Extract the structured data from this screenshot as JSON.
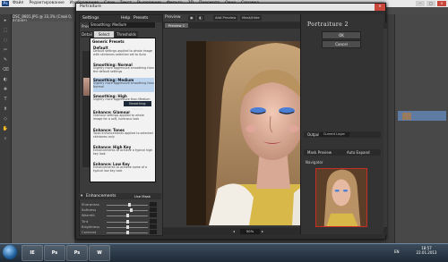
{
  "photoshop": {
    "logo": "Ps",
    "menus": [
      "Файл",
      "Редактирование",
      "Изображение",
      "Слои",
      "Текст",
      "Выделение",
      "Фильтр",
      "3D",
      "Просмотр",
      "Окно",
      "Справка"
    ],
    "window_buttons": [
      "–",
      "□",
      "×"
    ],
    "document_tab": "DSC_8801.JPG @ 33,3% (Слой 0, RGB/8*)"
  },
  "window": {
    "title": "Portraiture",
    "close": "×"
  },
  "settings": {
    "header": "Settings",
    "header_help": "Help",
    "header_presets": "Presets",
    "preset_label": "Preset:",
    "preset_value": "Smoothing: Medium",
    "tabs": [
      "Detail",
      "Select Only",
      "Thresholds"
    ]
  },
  "preset_list": {
    "group": "Generic Presets",
    "items": [
      {
        "name": "Default",
        "desc": "Default settings applied to whole image with skintones selection set to Auto"
      },
      {
        "name": "Smoothing: Normal",
        "desc": "Slightly more aggressive smoothing than the default settings"
      },
      {
        "name": "Smoothing: Medium",
        "desc": "Slightly more aggressive smoothing than Normal"
      },
      {
        "name": "Smoothing: High",
        "desc": "Slightly more aggressive than Medium"
      },
      {
        "name": "Enhance: Glamour",
        "desc": "Glamour settings applied to whole image for a soft, luminous look"
      },
      {
        "name": "Enhance: Tones",
        "desc": "Tonal enhancements applied to selected skintones only"
      },
      {
        "name": "Enhance: High Key",
        "desc": "Enhancements to achieve a typical high key look"
      },
      {
        "name": "Enhance: Low Key",
        "desc": "Enhancements to achieve some of a typical low key look"
      }
    ],
    "hover_tip": "Smoothing: Medium"
  },
  "enhancements": {
    "header": "Enhancements",
    "use_mask": "Use Mask",
    "rows": [
      {
        "label": "Sharpness",
        "value": 0.55
      },
      {
        "label": "Softness",
        "value": 0.6
      },
      {
        "label": "Warmth",
        "value": 0.5
      },
      {
        "label": "Tint",
        "value": 0.5
      },
      {
        "label": "Brightness",
        "value": 0.5
      },
      {
        "label": "Contrast",
        "value": 0.5
      }
    ]
  },
  "preview": {
    "title": "Preview",
    "add_preview": "Add Preview",
    "mask_button": "Mask/Hide",
    "fast_preview": "Fast Preview",
    "accurate": "Accurate",
    "tab": "Preview 1",
    "zoom": "50%"
  },
  "right": {
    "logo": "Portraiture 2",
    "ok": "OK",
    "cancel": "Cancel",
    "output_label": "Output",
    "output_value": "Current Layer",
    "mask_preview": "Mask Preview",
    "auto_expand": "Auto Expand",
    "navigator": "Navigator"
  },
  "taskbar": {
    "apps": [
      "IE",
      "Ps",
      "Ps",
      "W"
    ],
    "lang": "EN",
    "time": "18:57",
    "date": "22.01.2013"
  },
  "colors": {
    "accent": "#c72d25",
    "selection": "#bcd3ee"
  }
}
